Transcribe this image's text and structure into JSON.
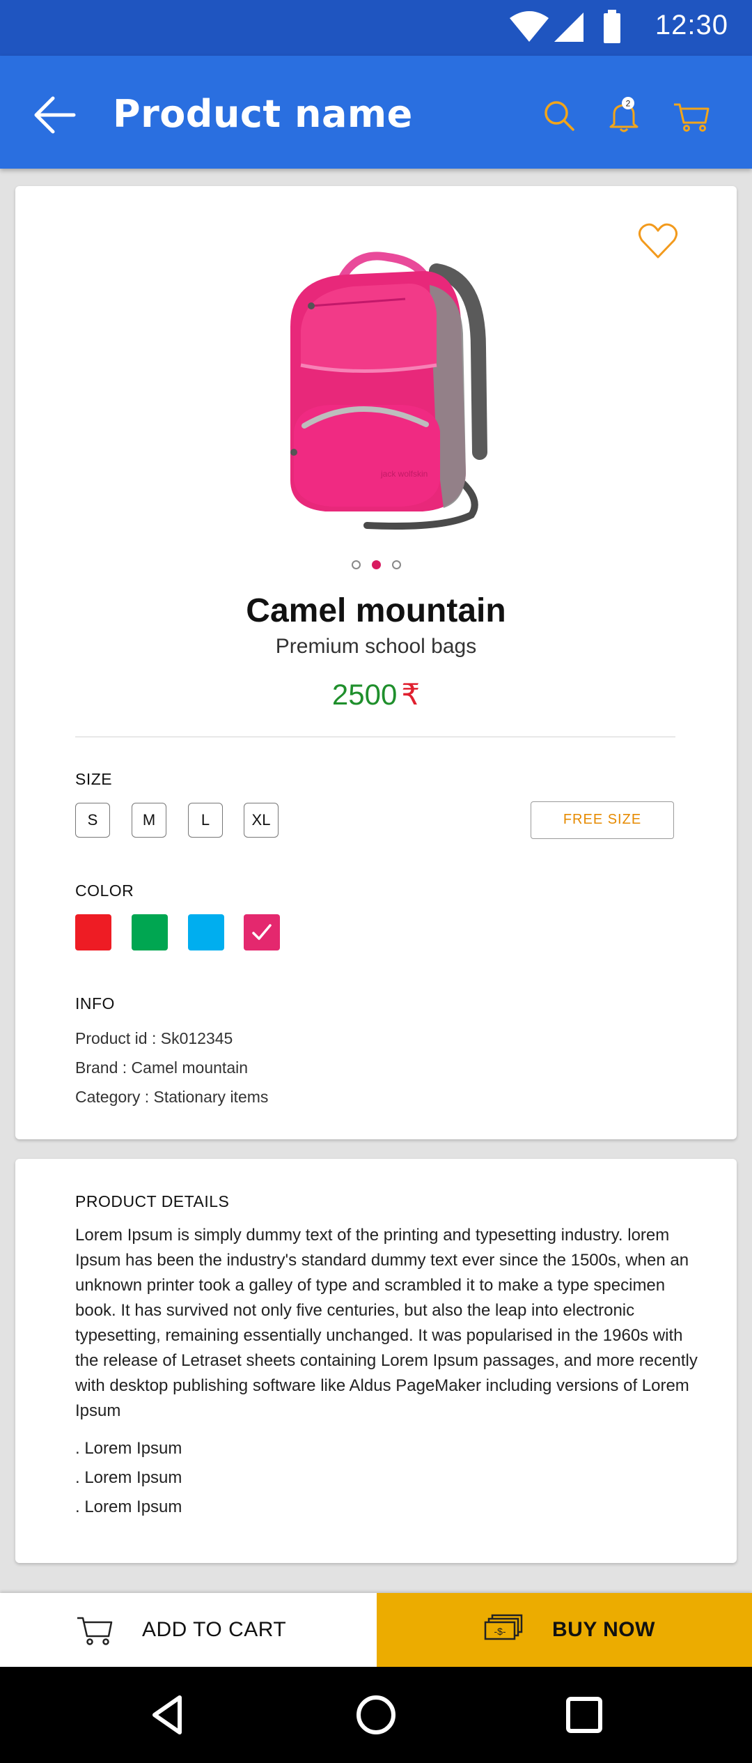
{
  "status_bar": {
    "time": "12:30"
  },
  "app_bar": {
    "title": "Product name",
    "notification_count": "2",
    "accent_color": "#f2a51a",
    "bar_color": "#2a6fe0"
  },
  "product": {
    "name": "Camel mountain",
    "subtitle": "Premium school bags",
    "price": "2500",
    "currency": "₹",
    "carousel": {
      "count": 3,
      "active": 1
    }
  },
  "size": {
    "label": "SIZE",
    "options": [
      "S",
      "M",
      "L",
      "XL"
    ],
    "free_size": "FREE SIZE"
  },
  "color": {
    "label": "COLOR",
    "swatches": [
      "#ee1c24",
      "#00a651",
      "#00aeef",
      "#e4286e"
    ],
    "selected": 3
  },
  "info": {
    "label": "INFO",
    "product_id": "Product id : Sk012345",
    "brand": "Brand : Camel mountain",
    "category": "Category : Stationary items"
  },
  "details": {
    "title": "PRODUCT DETAILS",
    "body": "Lorem Ipsum is simply dummy text of the printing and typesetting industry. lorem Ipsum has been the industry's standard dummy text ever since the 1500s, when an unknown printer took a galley of type and scrambled it to make a type specimen book. It has survived not only five centuries, but also the leap into electronic typesetting, remaining essentially unchanged. It was popularised in the 1960s with the release of Letraset sheets containing Lorem Ipsum passages, and more recently with desktop publishing software like Aldus PageMaker including versions of Lorem Ipsum",
    "bullets": [
      ". Lorem Ipsum",
      ". Lorem Ipsum",
      ". Lorem Ipsum"
    ]
  },
  "actions": {
    "add_to_cart": "ADD TO CART",
    "buy_now": "BUY NOW",
    "buy_color": "#ecac00"
  },
  "icons": {
    "status": [
      "wifi-icon",
      "signal-icon",
      "battery-icon"
    ],
    "app_bar": [
      "back-arrow-icon",
      "search-icon",
      "bell-icon",
      "cart-icon"
    ],
    "product": [
      "heart-icon"
    ],
    "nav": [
      "nav-back-icon",
      "nav-home-icon",
      "nav-recents-icon"
    ]
  }
}
